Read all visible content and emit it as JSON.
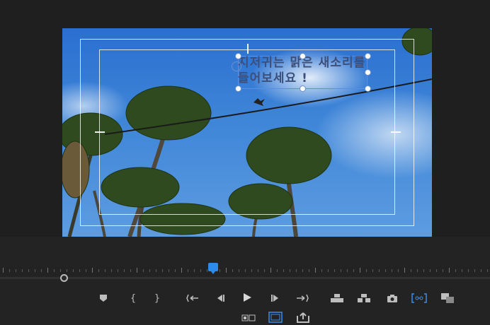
{
  "program_monitor": {
    "title_text": {
      "line1": "지저귀는 맑은 새소리를",
      "line2": "들어보세요 !"
    }
  },
  "timeline": {
    "playhead_position": 0.44
  },
  "controls": {
    "row1": [
      {
        "name": "add-marker-button-icon",
        "glyph": "⬟"
      },
      {
        "name": "mark-in-button-icon",
        "glyph": "{"
      },
      {
        "name": "mark-out-button-icon",
        "glyph": "}"
      },
      {
        "name": "go-to-in-button-icon",
        "glyph": "{←"
      },
      {
        "name": "step-back-button-icon",
        "glyph": "◀|"
      },
      {
        "name": "play-button-icon",
        "glyph": "▶"
      },
      {
        "name": "step-forward-button-icon",
        "glyph": "|▶"
      },
      {
        "name": "go-to-out-button-icon",
        "glyph": "→}"
      },
      {
        "name": "lift-button-icon",
        "glyph": "⇧"
      },
      {
        "name": "extract-button-icon",
        "glyph": "⇪"
      },
      {
        "name": "export-frame-button-icon",
        "glyph": "📷"
      },
      {
        "name": "vr-video-button-icon",
        "glyph": "[⊕]"
      },
      {
        "name": "comparison-view-button-icon",
        "glyph": "⧉"
      }
    ],
    "row2": [
      {
        "name": "multi-camera-button-icon",
        "glyph": "▭▭"
      },
      {
        "name": "safe-margins-button-icon",
        "glyph": "▢"
      },
      {
        "name": "share-button-icon",
        "glyph": "⇪"
      }
    ]
  }
}
